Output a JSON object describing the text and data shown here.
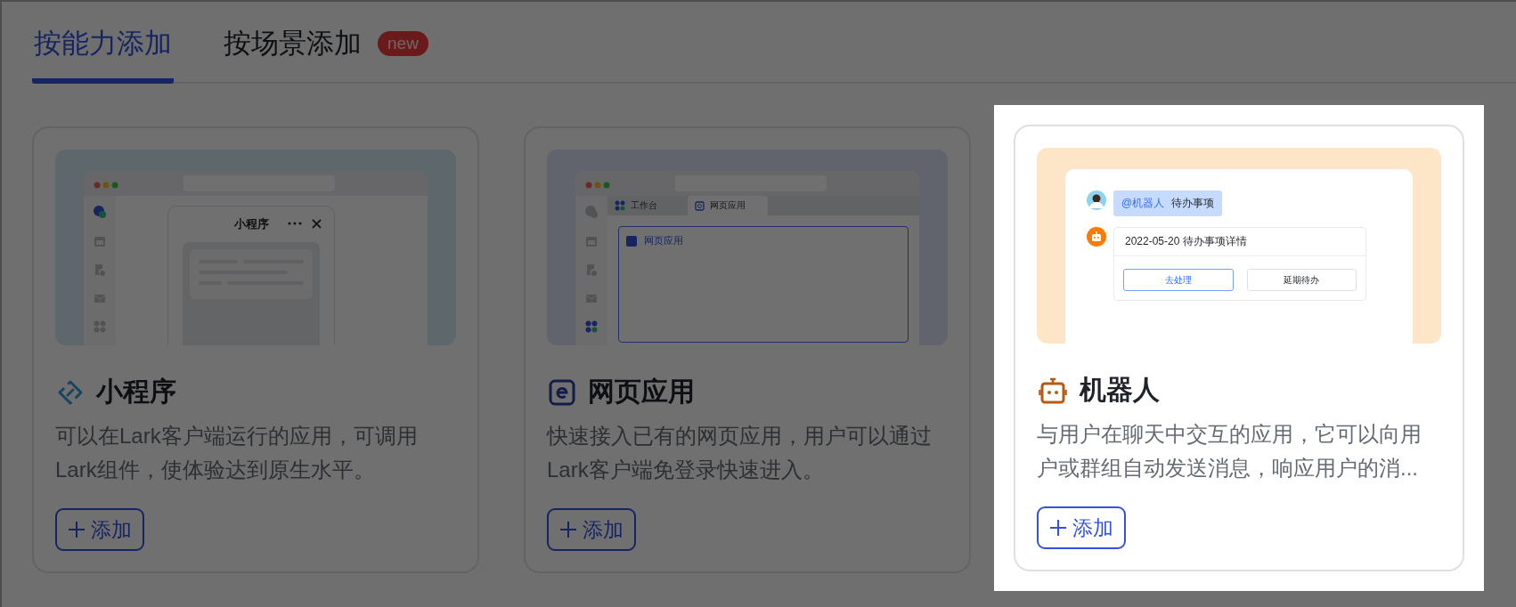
{
  "tabs": [
    {
      "label": "按能力添加",
      "selected": true
    },
    {
      "label": "按场景添加",
      "selected": false,
      "badge": "new"
    }
  ],
  "cards": [
    {
      "kind": "mini_program",
      "highlighted": false,
      "title": "小程序",
      "description": "可以在Lark客户端运行的应用，可调用Lark组件，使体验达到原生水平。",
      "button": "添加",
      "preview": {
        "kind": "mini_program",
        "panel_title": "小程序"
      }
    },
    {
      "kind": "web_app",
      "highlighted": false,
      "title": "网页应用",
      "description": "快速接入已有的网页应用，用户可以通过Lark客户端免登录快速进入。",
      "button": "添加",
      "preview": {
        "kind": "web_app",
        "tabs": [
          {
            "label": "工作台",
            "selected": false
          },
          {
            "label": "网页应用",
            "selected": true
          }
        ],
        "content_title": "网页应用"
      }
    },
    {
      "kind": "bot",
      "highlighted": true,
      "title": "机器人",
      "description": "与用户在聊天中交互的应用，它可以向用户或群组自动发送消息，响应用户的消...",
      "button": "添加",
      "preview": {
        "kind": "bot",
        "mention": "@机器人",
        "message": "待办事项",
        "card_title": "2022-05-20 待办事项详情",
        "actions": [
          {
            "label": "去处理",
            "primary": true
          },
          {
            "label": "延期待办",
            "primary": false
          }
        ]
      }
    }
  ]
}
